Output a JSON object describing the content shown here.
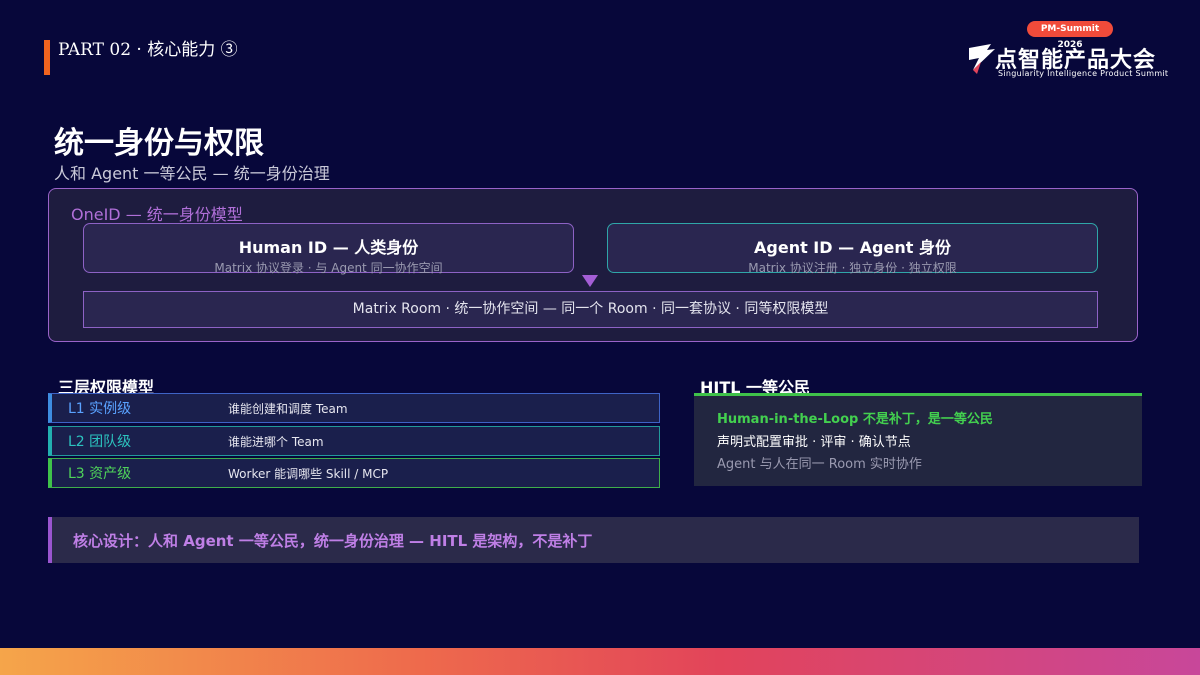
{
  "header": {
    "part_label": "PART 02 · 核心能力 ③",
    "accent_color": "#f0631f"
  },
  "logo": {
    "badge": "PM-Summit 2026",
    "name": "点智能产品大会",
    "subtitle": "Singularity Intelligence Product Summit"
  },
  "slide": {
    "title": "统一身份与权限",
    "subtitle": "人和 Agent 一等公民 — 统一身份治理"
  },
  "oneid": {
    "title": "OneID — 统一身份模型",
    "human": {
      "main": "Human ID — 人类身份",
      "sub": "Matrix 协议登录 · 与 Agent 同一协作空间"
    },
    "agent": {
      "main": "Agent ID — Agent 身份",
      "sub": "Matrix 协议注册 · 独立身份 · 独立权限"
    },
    "room": "Matrix Room · 统一协作空间 — 同一个 Room · 同一套协议 · 同等权限模型"
  },
  "permissions": {
    "title": "三层权限模型",
    "rows": [
      {
        "level": "L1 实例级",
        "desc": "谁能创建和调度 Team",
        "color": "#3e8de0"
      },
      {
        "level": "L2 团队级",
        "desc": "谁能进哪个 Team",
        "color": "#22b0b0"
      },
      {
        "level": "L3 资产级",
        "desc": "Worker 能调哪些 Skill / MCP",
        "color": "#3fc24a"
      }
    ]
  },
  "hitl": {
    "title": "HITL 一等公民",
    "line1": "Human-in-the-Loop 不是补丁，是一等公民",
    "line2": "声明式配置审批 · 评审 · 确认节点",
    "line3": "Agent 与人在同一 Room 实时协作"
  },
  "core": {
    "text": "核心设计：人和 Agent 一等公民，统一身份治理 — HITL 是架构，不是补丁"
  }
}
